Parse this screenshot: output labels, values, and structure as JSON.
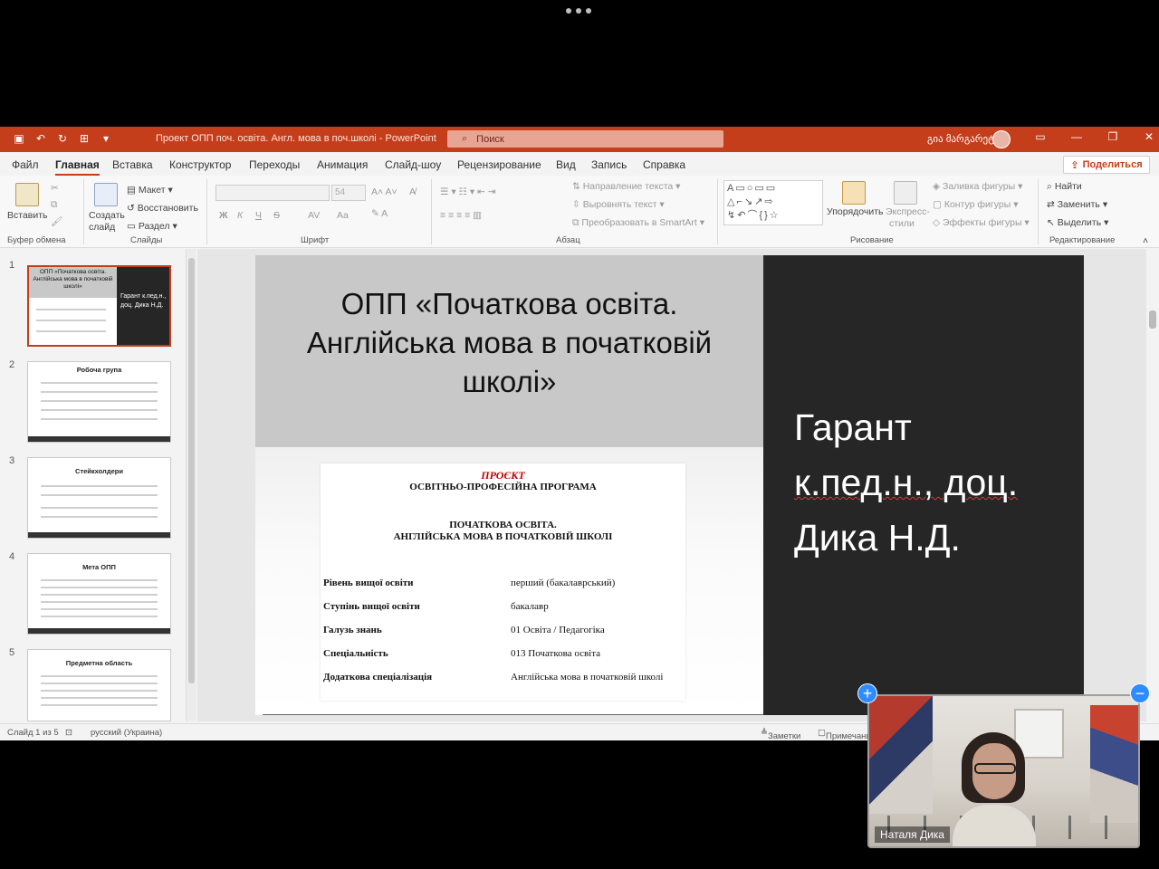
{
  "window": {
    "title": "Проект ОПП поч. освіта. Англ. мова в поч.школі  -  PowerPoint",
    "search_placeholder": "Поиск",
    "user_name": "გია მარგარეტ",
    "accent": "#c43e1c"
  },
  "menu": {
    "tabs": [
      "Файл",
      "Главная",
      "Вставка",
      "Конструктор",
      "Переходы",
      "Анимация",
      "Слайд-шоу",
      "Рецензирование",
      "Вид",
      "Запись",
      "Справка"
    ],
    "share_label": "Поделиться"
  },
  "ribbon": {
    "clipboard": {
      "paste": "Вставить",
      "group": "Буфер обмена"
    },
    "slides": {
      "new_slide_1": "Создать",
      "new_slide_2": "слайд",
      "layout": "Макет",
      "reset": "Восстановить",
      "section": "Раздел",
      "group": "Слайды"
    },
    "font": {
      "size": "54",
      "bold": "Ж",
      "italic": "К",
      "underline": "Ч",
      "strike": "S",
      "spacing": "AV",
      "case": "Aa",
      "group": "Шрифт"
    },
    "paragraph": {
      "text_direction": "Направление текста",
      "align_text": "Выровнять текст",
      "smartart": "Преобразовать в SmartArt",
      "group": "Абзац"
    },
    "drawing": {
      "arrange": "Упорядочить",
      "quick_styles_1": "Экспресс-",
      "quick_styles_2": "стили",
      "fill": "Заливка фигуры",
      "outline": "Контур фигуры",
      "effects": "Эффекты фигуры",
      "group": "Рисование"
    },
    "editing": {
      "find": "Найти",
      "replace": "Заменить",
      "select": "Выделить",
      "group": "Редактирование"
    }
  },
  "thumbnails": [
    {
      "num": "1",
      "title": "ОПП «Початкова освіта. Англійська мова в початковій школі»",
      "side": "Гарант к.пед.н., доц. Дика Н.Д."
    },
    {
      "num": "2",
      "title": "Робоча група"
    },
    {
      "num": "3",
      "title": "Стейкхолдери"
    },
    {
      "num": "4",
      "title": "Мета ОПП"
    },
    {
      "num": "5",
      "title": "Предметна область"
    }
  ],
  "slide": {
    "title": "ОПП «Початкова освіта. Англійська мова в початковій школі»",
    "guarant_line1": "Гарант",
    "guarant_line2": "к.пед.н., доц.",
    "guarant_line3": "Дика Н.Д.",
    "doc": {
      "project": "ПРОЄКТ",
      "program": "ОСВІТНЬО-ПРОФЕСІЙНА ПРОГРАМА",
      "sub1": "ПОЧАТКОВА ОСВІТА.",
      "sub2": "АНГЛІЙСЬКА МОВА В ПОЧАТКОВІЙ ШКОЛІ",
      "rows": [
        {
          "k": "Рівень вищої освіти",
          "v": "перший (бакалаврський)"
        },
        {
          "k": "Ступінь вищої освіти",
          "v": "бакалавр"
        },
        {
          "k": "Галузь знань",
          "v": "01 Освіта / Педагогіка"
        },
        {
          "k": "Спеціальність",
          "v": "013 Початкова освіта"
        },
        {
          "k": "Додаткова спеціалізація",
          "v": "Англійська мова в початковій школі"
        }
      ]
    }
  },
  "status": {
    "slide_of": "Слайд 1 из 5",
    "language": "русский (Украина)",
    "notes": "Заметки",
    "comments": "Примечания"
  },
  "video": {
    "participant": "Наталя Дика"
  }
}
